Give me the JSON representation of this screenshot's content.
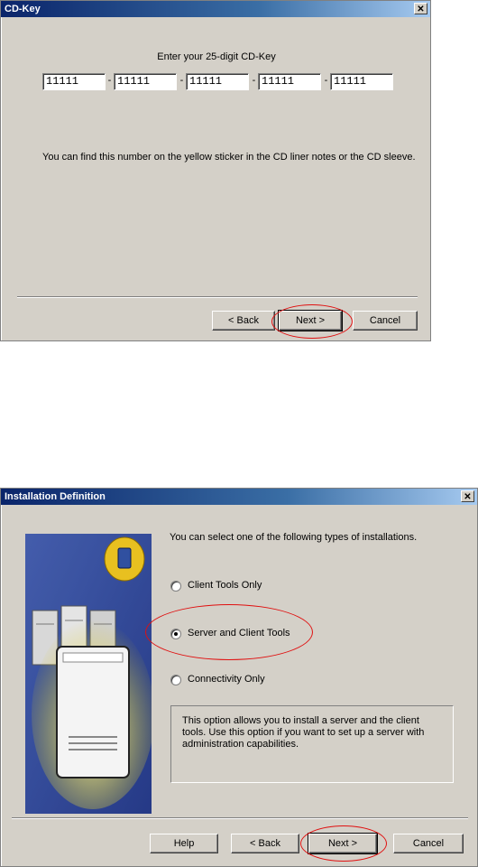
{
  "cd_key_dialog": {
    "title": "CD-Key",
    "close_glyph": "✕",
    "prompt": "Enter your 25-digit CD-Key",
    "key_fields": [
      "11111",
      "11111",
      "11111",
      "11111",
      "11111"
    ],
    "dash": "-",
    "hint": "You can find this number on the yellow sticker in the CD liner notes or the CD sleeve.",
    "buttons": {
      "back": "< Back",
      "next": "Next >",
      "cancel": "Cancel"
    }
  },
  "install_dialog": {
    "title": "Installation Definition",
    "close_glyph": "✕",
    "heading": "You can select one of the following types of installations.",
    "options": [
      {
        "label": "Client Tools Only",
        "selected": false
      },
      {
        "label": "Server and Client Tools",
        "selected": true
      },
      {
        "label": "Connectivity Only",
        "selected": false
      }
    ],
    "description": "This option allows you to install a server and the client tools. Use this option if you want to set up a server with administration capabilities.",
    "buttons": {
      "help": "Help",
      "back": "< Back",
      "next": "Next >",
      "cancel": "Cancel"
    }
  },
  "colors": {
    "dialog_bg": "#d4d0c8",
    "title_bar": "#0a246a",
    "highlight_ring": "#e01010"
  }
}
